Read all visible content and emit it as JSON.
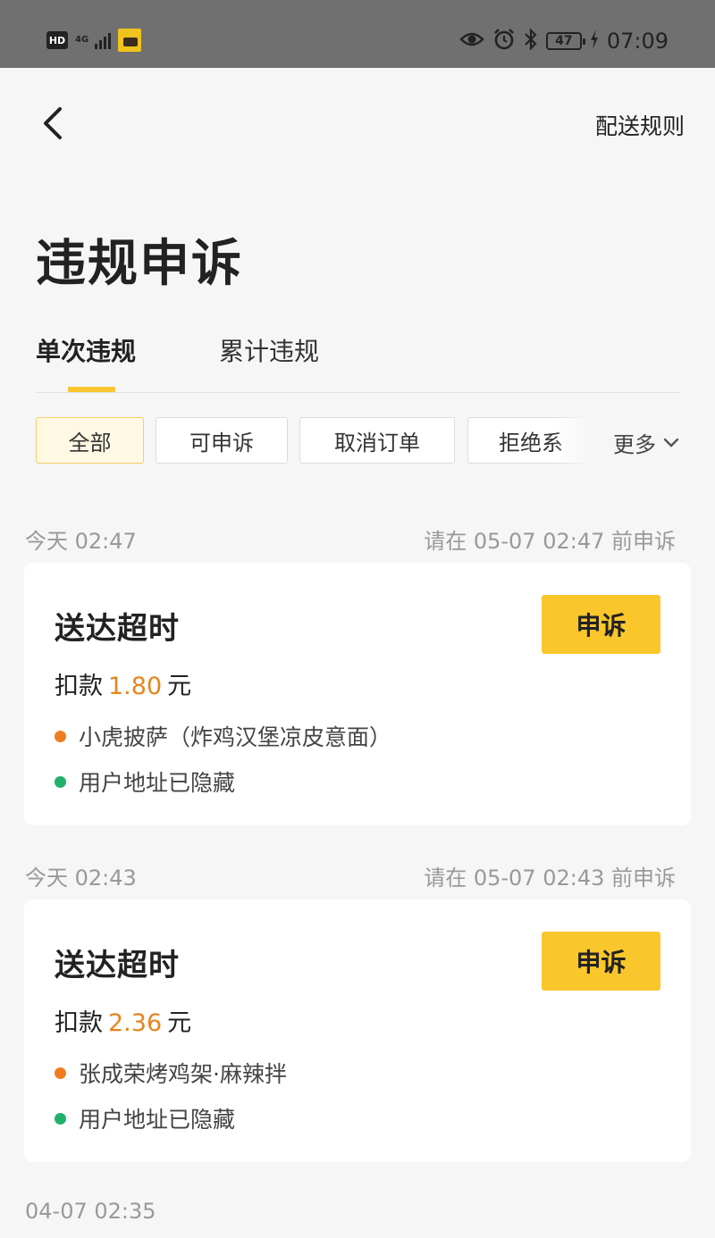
{
  "status_bar": {
    "hd": "HD",
    "network": "4G",
    "battery": "47",
    "time": "07:09"
  },
  "header": {
    "back_icon": "chevron-left-icon",
    "rules_link": "配送规则",
    "title": "违规申诉"
  },
  "tabs": [
    {
      "label": "单次违规",
      "active": true
    },
    {
      "label": "累计违规",
      "active": false
    }
  ],
  "filters": [
    {
      "label": "全部",
      "active": true
    },
    {
      "label": "可申诉",
      "active": false
    },
    {
      "label": "取消订单",
      "active": false
    },
    {
      "label": "拒绝系",
      "active": false
    }
  ],
  "more": {
    "label": "更多"
  },
  "records": [
    {
      "time": "今天 02:47",
      "deadline": "请在 05-07 02:47 前申诉",
      "type": "送达超时",
      "appeal_label": "申诉",
      "deduct_prefix": "扣款",
      "amount": "1.80",
      "unit": "元",
      "shop": "小虎披萨（炸鸡汉堡凉皮意面）",
      "address": "用户地址已隐藏"
    },
    {
      "time": "今天 02:43",
      "deadline": "请在 05-07 02:43 前申诉",
      "type": "送达超时",
      "appeal_label": "申诉",
      "deduct_prefix": "扣款",
      "amount": "2.36",
      "unit": "元",
      "shop": "张成荣烤鸡架·麻辣拌",
      "address": "用户地址已隐藏"
    },
    {
      "time": "04-07 02:35"
    }
  ],
  "colors": {
    "accent": "#f9c72c",
    "amount": "#e8841f",
    "shop_dot": "#ef7d20",
    "address_dot": "#21b16b"
  }
}
